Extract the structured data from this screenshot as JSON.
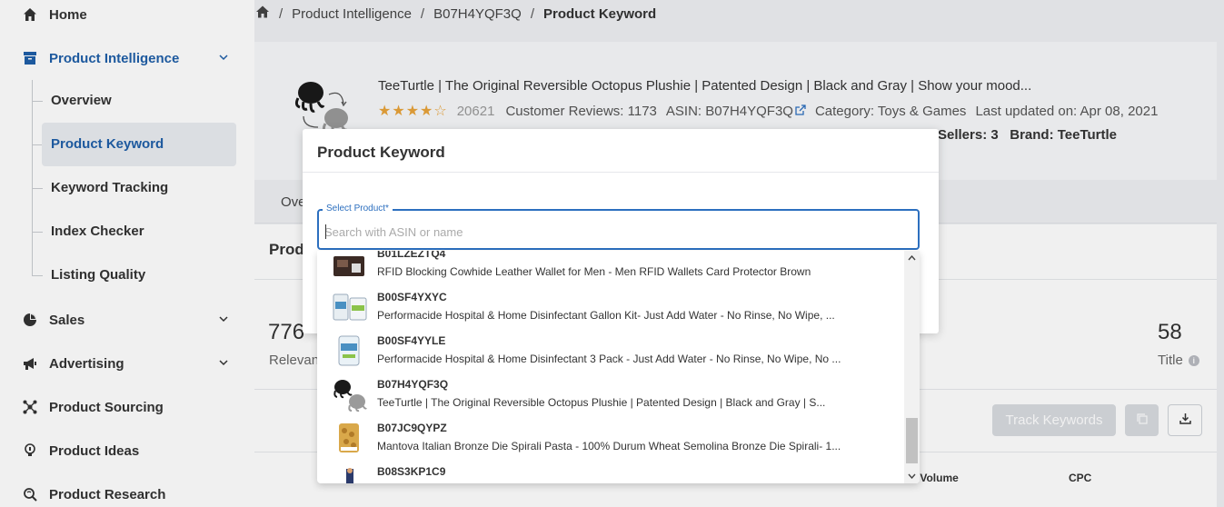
{
  "sidebar": {
    "items": [
      {
        "label": "Home",
        "icon": "home-icon"
      },
      {
        "label": "Product Intelligence",
        "icon": "box-icon"
      },
      {
        "label": "Sales",
        "icon": "pie-chart-icon"
      },
      {
        "label": "Advertising",
        "icon": "megaphone-icon"
      },
      {
        "label": "Product Sourcing",
        "icon": "network-icon"
      },
      {
        "label": "Product Ideas",
        "icon": "bulb-icon"
      },
      {
        "label": "Product Research",
        "icon": "search-icon"
      }
    ],
    "subitems": [
      "Overview",
      "Product Keyword",
      "Keyword Tracking",
      "Index Checker",
      "Listing Quality"
    ],
    "active_subitem": "Product Keyword",
    "accent": "#1f5fa8"
  },
  "breadcrumb": {
    "items": [
      "Product Intelligence",
      "B07H4YQF3Q"
    ],
    "current": "Product Keyword"
  },
  "product": {
    "title": "TeeTurtle | The Original Reversible Octopus Plushie | Patented Design | Black and Gray | Show your mood...",
    "stars": "★★★★☆",
    "rating_count": "20621",
    "customer_reviews": "Customer Reviews: 1173",
    "asin": "ASIN: B07H4YQF3Q",
    "category": "Category: Toys & Games",
    "last_updated": "Last updated on: Apr 08, 2021",
    "sellers": "Sellers: 3",
    "brand": "Brand: TeeTurtle"
  },
  "tabs": {
    "first_partial": "Ove"
  },
  "section": {
    "title_partial": "Prod"
  },
  "stats": {
    "left_value": "776",
    "left_label": "Relevant",
    "right_value": "58",
    "right_label": "Title"
  },
  "actions": {
    "track_keywords": "Track Keywords"
  },
  "table": {
    "search_volume_partial": "ch Volume",
    "cpc": "CPC"
  },
  "modal": {
    "title": "Product Keyword",
    "select_label": "Select Product*",
    "select_placeholder": "Search with ASIN or name",
    "options": [
      {
        "asin": "B01LZEZTQ4",
        "name": "RFID Blocking Cowhide Leather Wallet for Men - Men RFID Wallets Card Protector Brown"
      },
      {
        "asin": "B00SF4YXYC",
        "name": "Performacide Hospital & Home Disinfectant Gallon Kit- Just Add Water - No Rinse, No Wipe, ..."
      },
      {
        "asin": "B00SF4YYLE",
        "name": "Performacide Hospital & Home Disinfectant 3 Pack - Just Add Water - No Rinse, No Wipe, No ..."
      },
      {
        "asin": "B07H4YQF3Q",
        "name": "TeeTurtle | The Original Reversible Octopus Plushie | Patented Design | Black and Gray | S..."
      },
      {
        "asin": "B07JC9QYPZ",
        "name": "Mantova Italian Bronze Die Spirali Pasta - 100% Durum Wheat Semolina Bronze Die Spirali- 1..."
      },
      {
        "asin": "B08S3KP1C9",
        "name": ""
      }
    ],
    "accent": "#2c6fbf"
  }
}
